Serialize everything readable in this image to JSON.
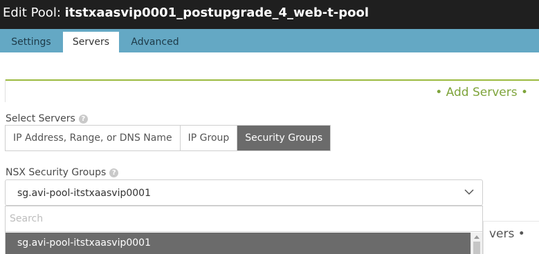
{
  "title": {
    "prefix": "Edit Pool: ",
    "pool_name": "itstxaasvip0001_postupgrade_4_web-t-pool"
  },
  "tabs": [
    {
      "label": "Settings",
      "active": false
    },
    {
      "label": "Servers",
      "active": true
    },
    {
      "label": "Advanced",
      "active": false
    }
  ],
  "add_servers": {
    "label": "• Add Servers •"
  },
  "select_servers": {
    "label": "Select Servers",
    "help_icon": "question-circle-icon",
    "options": [
      {
        "label": "IP Address, Range, or DNS Name",
        "active": false
      },
      {
        "label": "IP Group",
        "active": false
      },
      {
        "label": "Security Groups",
        "active": true
      }
    ]
  },
  "nsx_security_groups": {
    "label": "NSX Security Groups",
    "help_icon": "question-circle-icon",
    "selected_value": "sg.avi-pool-itstxaasvip0001",
    "chevron_icon": "chevron-down-icon",
    "search_placeholder": "Search",
    "search_value": "",
    "list_options": [
      "sg.avi-pool-itstxaasvip0001"
    ]
  },
  "background_card_text": "vers •",
  "colors": {
    "titlebar": "#1f1f1f",
    "tabbar": "#64a8c4",
    "accent_green": "#7ea43b",
    "selected_segment": "#6b6b6b"
  }
}
